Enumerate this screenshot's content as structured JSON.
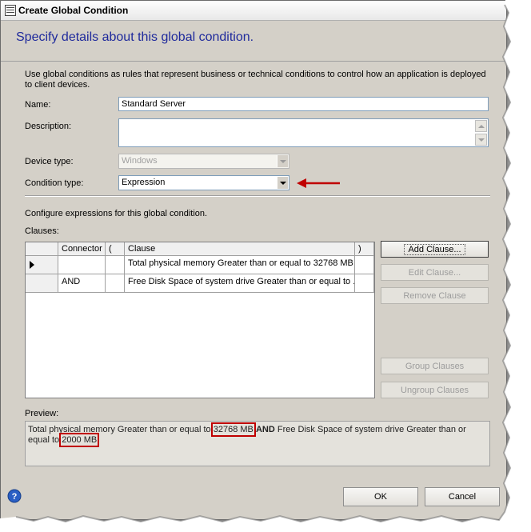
{
  "window": {
    "title": "Create Global Condition"
  },
  "header": {
    "title": "Specify details about this global condition."
  },
  "intro": "Use global conditions as rules that represent business or technical conditions to control how an application is deployed to client devices.",
  "fields": {
    "name_label": "Name:",
    "name_value": "Standard Server",
    "description_label": "Description:",
    "description_value": "",
    "device_type_label": "Device type:",
    "device_type_value": "Windows",
    "condition_type_label": "Condition type:",
    "condition_type_value": "Expression"
  },
  "expressions_label": "Configure expressions for this global condition.",
  "clauses": {
    "label": "Clauses:",
    "columns": [
      "Connector",
      "(",
      "Clause",
      ")"
    ],
    "rows": [
      {
        "connector": "",
        "open": "",
        "clause": "Total physical memory Greater than or equal to 32768 MB",
        "close": ""
      },
      {
        "connector": "AND",
        "open": "",
        "clause": "Free Disk Space of system drive Greater than or equal to ...",
        "close": ""
      }
    ]
  },
  "buttons": {
    "add_clause": "Add Clause...",
    "edit_clause": "Edit Clause...",
    "remove_clause": "Remove Clause",
    "group_clauses": "Group Clauses",
    "ungroup_clauses": "Ungroup Clauses",
    "ok": "OK",
    "cancel": "Cancel"
  },
  "preview": {
    "label": "Preview:",
    "part1": "Total physical memory Greater than or equal to ",
    "value1": "32768 MB",
    "connector": "AND",
    "part2": " Free Disk Space of system drive Greater than or equal to ",
    "value2": "2000 MB"
  },
  "colors": {
    "header_text": "#1f2a9c",
    "highlight": "#c00000",
    "arrow": "#c00000"
  }
}
